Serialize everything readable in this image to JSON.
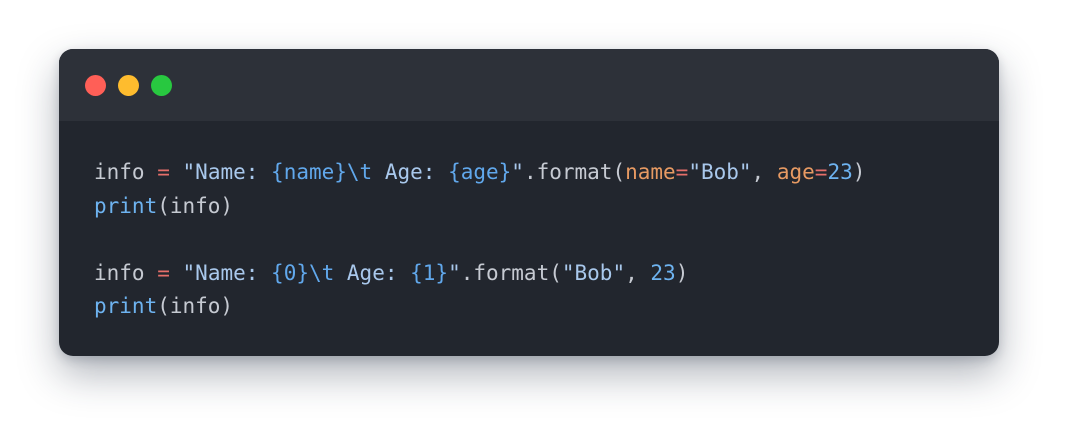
{
  "window": {
    "traffic_lights": [
      {
        "name": "close",
        "color": "#ff5f57"
      },
      {
        "name": "minimize",
        "color": "#febc2e"
      },
      {
        "name": "maximize",
        "color": "#28c840"
      }
    ]
  },
  "code": {
    "lines": [
      [
        {
          "t": "info ",
          "c": "plain"
        },
        {
          "t": "=",
          "c": "op"
        },
        {
          "t": " ",
          "c": "plain"
        },
        {
          "t": "\"Name: ",
          "c": "string"
        },
        {
          "t": "{name}\\t",
          "c": "interp"
        },
        {
          "t": " Age: ",
          "c": "string"
        },
        {
          "t": "{age}",
          "c": "interp"
        },
        {
          "t": "\"",
          "c": "string"
        },
        {
          "t": ".format(",
          "c": "plain"
        },
        {
          "t": "name",
          "c": "kw"
        },
        {
          "t": "=",
          "c": "op"
        },
        {
          "t": "\"Bob\"",
          "c": "string"
        },
        {
          "t": ", ",
          "c": "plain"
        },
        {
          "t": "age",
          "c": "kw"
        },
        {
          "t": "=",
          "c": "op"
        },
        {
          "t": "23",
          "c": "num"
        },
        {
          "t": ")",
          "c": "plain"
        }
      ],
      [
        {
          "t": "print",
          "c": "builtin"
        },
        {
          "t": "(info)",
          "c": "plain"
        }
      ],
      [],
      [
        {
          "t": "info ",
          "c": "plain"
        },
        {
          "t": "=",
          "c": "op"
        },
        {
          "t": " ",
          "c": "plain"
        },
        {
          "t": "\"Name: ",
          "c": "string"
        },
        {
          "t": "{0}\\t",
          "c": "interp"
        },
        {
          "t": " Age: ",
          "c": "string"
        },
        {
          "t": "{1}",
          "c": "interp"
        },
        {
          "t": "\"",
          "c": "string"
        },
        {
          "t": ".format(",
          "c": "plain"
        },
        {
          "t": "\"Bob\"",
          "c": "string"
        },
        {
          "t": ", ",
          "c": "plain"
        },
        {
          "t": "23",
          "c": "num"
        },
        {
          "t": ")",
          "c": "plain"
        }
      ],
      [
        {
          "t": "print",
          "c": "builtin"
        },
        {
          "t": "(info)",
          "c": "plain"
        }
      ]
    ]
  }
}
